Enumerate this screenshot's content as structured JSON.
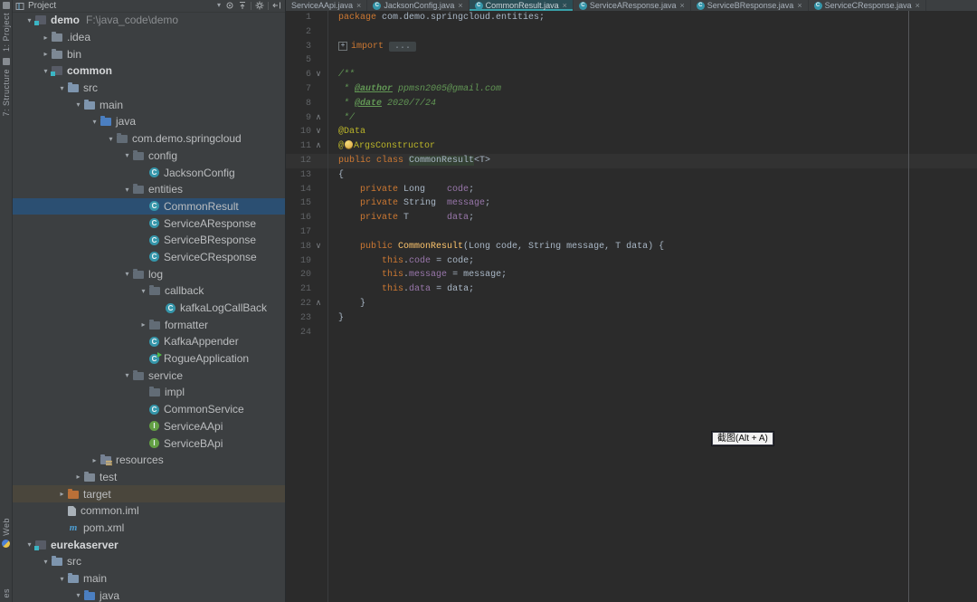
{
  "colors": {
    "panel_bg": "#3C3F41",
    "editor_bg": "#2B2B2B",
    "selection_blue": "#2B4F72",
    "hover_brown": "#4A463C",
    "active_tab_teal": "#2B4D55",
    "tab_underline": "#39A0A8",
    "keyword_orange": "#CC7832",
    "annotation_yellow": "#BBB529",
    "field_purple": "#9876AA",
    "comment_green": "#629755",
    "constructor_yellow": "#FFC66D",
    "line_number_gray": "#606366"
  },
  "stripe": {
    "top_buttons": [
      {
        "label": "1: Project",
        "icon": "project-tool-icon"
      },
      {
        "label": "7: Structure",
        "icon": "structure-tool-icon"
      }
    ],
    "bottom_buttons": [
      {
        "label": "Web",
        "icon": "globe-icon"
      },
      {
        "label": "es",
        "icon": ""
      }
    ]
  },
  "project_panel": {
    "header": {
      "title": "Project",
      "icons": [
        "locate-icon",
        "collapse-all-icon",
        "settings-gear-icon",
        "hide-panel-icon"
      ]
    },
    "tree": [
      {
        "label": "demo",
        "suffix": "F:\\java_code\\demo",
        "type": "module",
        "level": 0,
        "arrow": "open",
        "bold": true
      },
      {
        "label": ".idea",
        "type": "folder",
        "level": 1,
        "arrow": "closed"
      },
      {
        "label": "bin",
        "type": "folder",
        "level": 1,
        "arrow": "closed"
      },
      {
        "label": "common",
        "type": "module",
        "level": 1,
        "arrow": "open",
        "bold": true
      },
      {
        "label": "src",
        "type": "folder-main",
        "level": 2,
        "arrow": "open"
      },
      {
        "label": "main",
        "type": "folder-main",
        "level": 3,
        "arrow": "open"
      },
      {
        "label": "java",
        "type": "folder-src",
        "level": 4,
        "arrow": "open"
      },
      {
        "label": "com.demo.springcloud",
        "type": "package",
        "level": 5,
        "arrow": "open"
      },
      {
        "label": "config",
        "type": "package",
        "level": 6,
        "arrow": "open"
      },
      {
        "label": "JacksonConfig",
        "type": "class",
        "level": 7,
        "arrow": "none"
      },
      {
        "label": "entities",
        "type": "package",
        "level": 6,
        "arrow": "open"
      },
      {
        "label": "CommonResult",
        "type": "class",
        "level": 7,
        "arrow": "none",
        "state": "selected"
      },
      {
        "label": "ServiceAResponse",
        "type": "class",
        "level": 7,
        "arrow": "none"
      },
      {
        "label": "ServiceBResponse",
        "type": "class",
        "level": 7,
        "arrow": "none"
      },
      {
        "label": "ServiceCResponse",
        "type": "class",
        "level": 7,
        "arrow": "none"
      },
      {
        "label": "log",
        "type": "package",
        "level": 6,
        "arrow": "open"
      },
      {
        "label": "callback",
        "type": "package",
        "level": 7,
        "arrow": "open"
      },
      {
        "label": "kafkaLogCallBack",
        "type": "class",
        "level": 8,
        "arrow": "none"
      },
      {
        "label": "formatter",
        "type": "package",
        "level": 7,
        "arrow": "closed"
      },
      {
        "label": "KafkaAppender",
        "type": "class",
        "level": 7,
        "arrow": "none"
      },
      {
        "label": "RogueApplication",
        "type": "class-run",
        "level": 7,
        "arrow": "none"
      },
      {
        "label": "service",
        "type": "package",
        "level": 6,
        "arrow": "open"
      },
      {
        "label": "impl",
        "type": "package",
        "level": 7,
        "arrow": "none"
      },
      {
        "label": "CommonService",
        "type": "class",
        "level": 7,
        "arrow": "none"
      },
      {
        "label": "ServiceAApi",
        "type": "interface",
        "level": 7,
        "arrow": "none"
      },
      {
        "label": "ServiceBApi",
        "type": "interface",
        "level": 7,
        "arrow": "none"
      },
      {
        "label": "resources",
        "type": "folder-res",
        "level": 4,
        "arrow": "closed"
      },
      {
        "label": "test",
        "type": "folder",
        "level": 3,
        "arrow": "closed"
      },
      {
        "label": "target",
        "type": "folder-excl",
        "level": 2,
        "arrow": "closed",
        "state": "hover"
      },
      {
        "label": "common.iml",
        "type": "file",
        "level": 2,
        "arrow": "none"
      },
      {
        "label": "pom.xml",
        "type": "maven",
        "level": 2,
        "arrow": "none"
      },
      {
        "label": "eurekaserver",
        "type": "module",
        "level": 0,
        "arrow": "open",
        "bold": true
      },
      {
        "label": "src",
        "type": "folder-main",
        "level": 1,
        "arrow": "open"
      },
      {
        "label": "main",
        "type": "folder-main",
        "level": 2,
        "arrow": "open"
      },
      {
        "label": "java",
        "type": "folder-src",
        "level": 3,
        "arrow": "open"
      }
    ]
  },
  "tabs": [
    {
      "label": "ServiceAApi.java",
      "active": false,
      "icon": false
    },
    {
      "label": "JacksonConfig.java",
      "active": false,
      "icon": true
    },
    {
      "label": "CommonResult.java",
      "active": true,
      "icon": true
    },
    {
      "label": "ServiceAResponse.java",
      "active": false,
      "icon": true
    },
    {
      "label": "ServiceBResponse.java",
      "active": false,
      "icon": true
    },
    {
      "label": "ServiceCResponse.java",
      "active": false,
      "icon": true
    }
  ],
  "editor": {
    "lines": [
      {
        "num": "1",
        "tokens": [
          [
            "kw",
            "package"
          ],
          [
            "pl",
            " com.demo.springcloud.entities;"
          ]
        ]
      },
      {
        "num": "2",
        "tokens": []
      },
      {
        "num": "3",
        "tokens": [
          [
            "plus",
            "+"
          ],
          [
            "kw",
            "import "
          ],
          [
            "fold",
            " ... "
          ]
        ]
      },
      {
        "num": "5",
        "tokens": []
      },
      {
        "num": "6",
        "marker": "v",
        "tokens": [
          [
            "cm",
            "/**"
          ]
        ]
      },
      {
        "num": "7",
        "tokens": [
          [
            "cm",
            " * "
          ],
          [
            "ct",
            "@author"
          ],
          [
            "ci",
            " ppmsn2005@gmail.com"
          ]
        ]
      },
      {
        "num": "8",
        "tokens": [
          [
            "cm",
            " * "
          ],
          [
            "ct",
            "@date"
          ],
          [
            "ci",
            " 2020/7/24"
          ]
        ]
      },
      {
        "num": "9",
        "marker": "^",
        "tokens": [
          [
            "cm",
            " */"
          ]
        ]
      },
      {
        "num": "10",
        "marker": "v",
        "tokens": [
          [
            "an",
            "@Data"
          ]
        ]
      },
      {
        "num": "11",
        "marker": "^",
        "tokens": [
          [
            "an",
            "@"
          ],
          [
            "bulb",
            ""
          ],
          [
            "an",
            "ArgsConstructor"
          ]
        ]
      },
      {
        "num": "12",
        "current": true,
        "tokens": [
          [
            "kw",
            "public class "
          ],
          [
            "hl",
            "CommonResult"
          ],
          [
            "pl",
            "<T>"
          ]
        ]
      },
      {
        "num": "13",
        "tokens": [
          [
            "pl",
            "{"
          ]
        ]
      },
      {
        "num": "14",
        "tokens": [
          [
            "pl",
            "    "
          ],
          [
            "kw",
            "private"
          ],
          [
            "pl",
            " Long    "
          ],
          [
            "fd",
            "code"
          ],
          [
            "pl",
            ";"
          ]
        ]
      },
      {
        "num": "15",
        "tokens": [
          [
            "pl",
            "    "
          ],
          [
            "kw",
            "private"
          ],
          [
            "pl",
            " String  "
          ],
          [
            "fd",
            "message"
          ],
          [
            "pl",
            ";"
          ]
        ]
      },
      {
        "num": "16",
        "tokens": [
          [
            "pl",
            "    "
          ],
          [
            "kw",
            "private"
          ],
          [
            "pl",
            " T       "
          ],
          [
            "fd",
            "data"
          ],
          [
            "pl",
            ";"
          ]
        ]
      },
      {
        "num": "17",
        "tokens": []
      },
      {
        "num": "18",
        "marker": "v",
        "tokens": [
          [
            "pl",
            "    "
          ],
          [
            "kw",
            "public "
          ],
          [
            "ctor",
            "CommonResult"
          ],
          [
            "pl",
            "(Long code, String message, T data) {"
          ]
        ]
      },
      {
        "num": "19",
        "tokens": [
          [
            "pl",
            "        "
          ],
          [
            "kw",
            "this"
          ],
          [
            "pl",
            "."
          ],
          [
            "fd",
            "code"
          ],
          [
            "pl",
            " = code;"
          ]
        ]
      },
      {
        "num": "20",
        "tokens": [
          [
            "pl",
            "        "
          ],
          [
            "kw",
            "this"
          ],
          [
            "pl",
            "."
          ],
          [
            "fd",
            "message"
          ],
          [
            "pl",
            " = message;"
          ]
        ]
      },
      {
        "num": "21",
        "tokens": [
          [
            "pl",
            "        "
          ],
          [
            "kw",
            "this"
          ],
          [
            "pl",
            "."
          ],
          [
            "fd",
            "data"
          ],
          [
            "pl",
            " = data;"
          ]
        ]
      },
      {
        "num": "22",
        "marker": "^",
        "tokens": [
          [
            "pl",
            "    }"
          ]
        ]
      },
      {
        "num": "23",
        "tokens": [
          [
            "pl",
            "}"
          ]
        ]
      },
      {
        "num": "24",
        "tokens": []
      }
    ]
  },
  "tooltip": {
    "text": "截图(Alt + A)"
  }
}
